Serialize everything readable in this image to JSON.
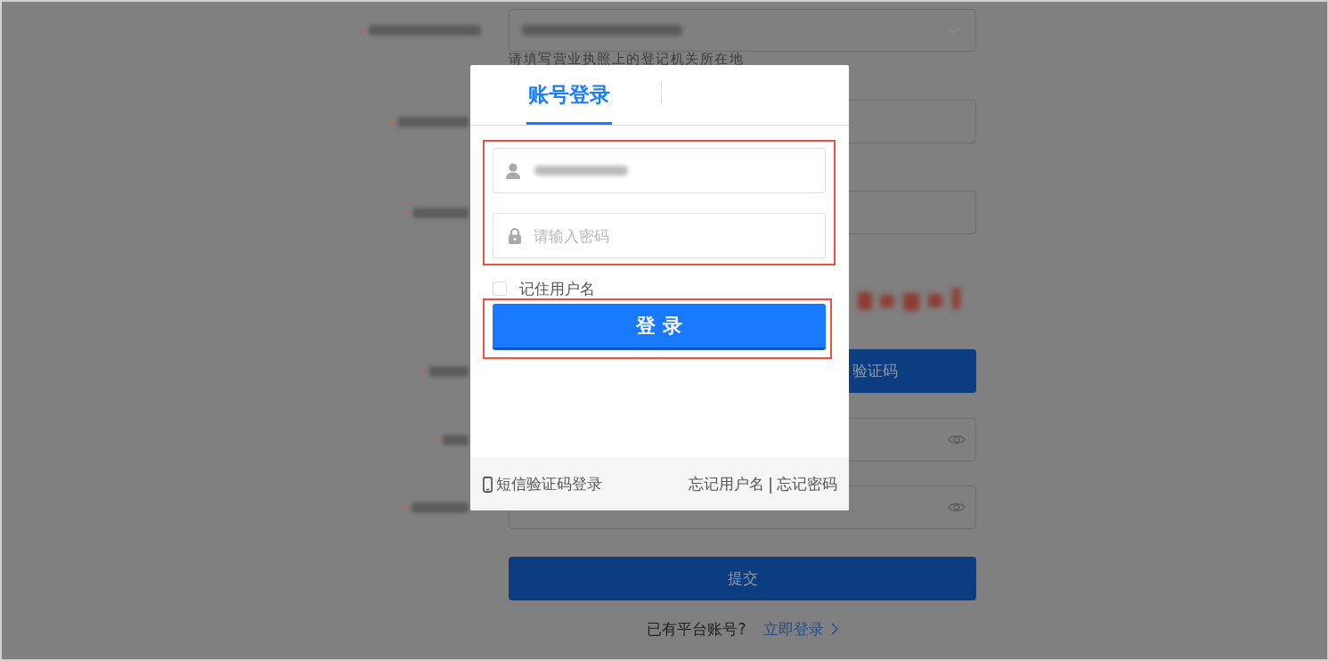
{
  "form": {
    "rows": [
      {
        "kind": "select",
        "label_blurred": true,
        "value_blurred": true
      },
      {
        "kind": "hint",
        "text": "请填写营业执照上的登记机关所在地"
      },
      {
        "kind": "input",
        "label_blurred": true
      },
      {
        "kind": "input",
        "label_blurred": true
      },
      {
        "kind": "captcha"
      },
      {
        "kind": "sms",
        "label_blurred": true,
        "button": "验证码"
      },
      {
        "kind": "password",
        "label_blurred": true
      },
      {
        "kind": "password",
        "label_blurred": true
      }
    ],
    "submit": "提交",
    "login_prompt": {
      "text": "已有平台账号?",
      "link": "立即登录"
    }
  },
  "dialog": {
    "tabs": [
      {
        "label": "账号登录",
        "selected": true
      }
    ],
    "credentials_highlighted": true,
    "username": {
      "value_blurred": true
    },
    "password": {
      "placeholder": "请输入密码"
    },
    "remember": {
      "label": "记住用户名",
      "checked": false
    },
    "login_button": {
      "label": "登 录",
      "highlighted": true
    },
    "footer": {
      "sms_login": "短信验证码登录",
      "forgot_username": "忘记用户名",
      "separator": "|",
      "forgot_password": "忘记密码"
    }
  }
}
